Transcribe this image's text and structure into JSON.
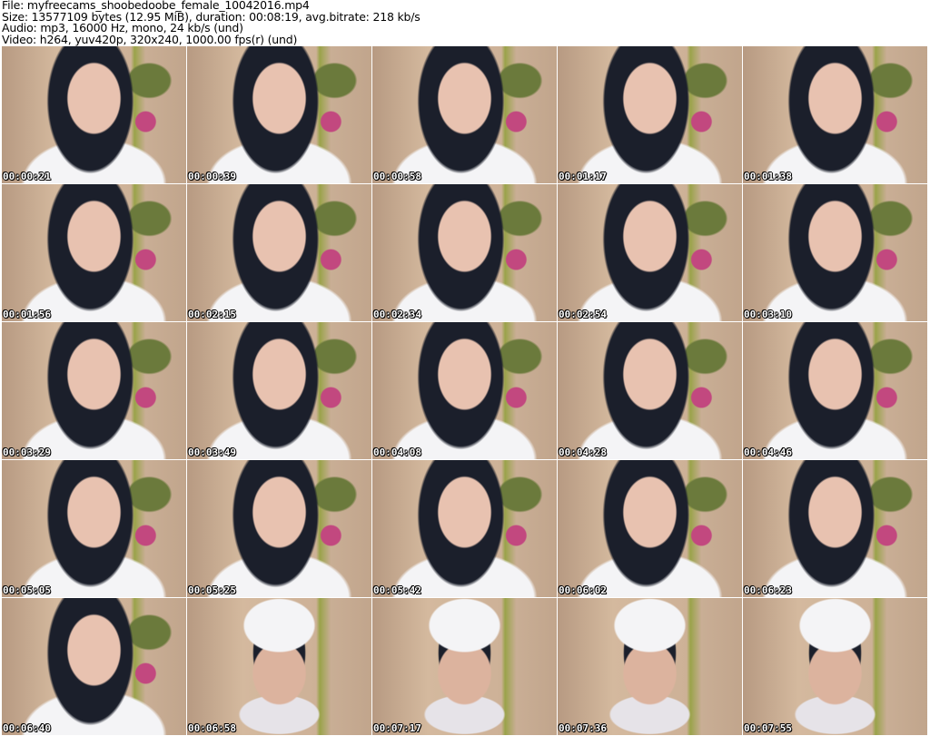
{
  "header": {
    "file": "File: myfreecams_shoobedoobe_female_10042016.mp4",
    "size": "Size: 13577109 bytes (12.95 MiB), duration: 00:08:19, avg.bitrate: 218 kb/s",
    "audio": "Audio: mp3, 16000 Hz, mono, 24 kb/s (und)",
    "video": "Video: h264, yuv420p, 320x240, 1000.00 fps(r) (und)"
  },
  "thumbnails": [
    "00:00:21",
    "00:00:39",
    "00:00:58",
    "00:01:17",
    "00:01:38",
    "00:01:56",
    "00:02:15",
    "00:02:34",
    "00:02:54",
    "00:03:10",
    "00:03:29",
    "00:03:49",
    "00:04:08",
    "00:04:28",
    "00:04:46",
    "00:05:05",
    "00:05:25",
    "00:05:42",
    "00:06:02",
    "00:06:23",
    "00:06:40",
    "00:06:58",
    "00:07:17",
    "00:07:36",
    "00:07:55"
  ]
}
